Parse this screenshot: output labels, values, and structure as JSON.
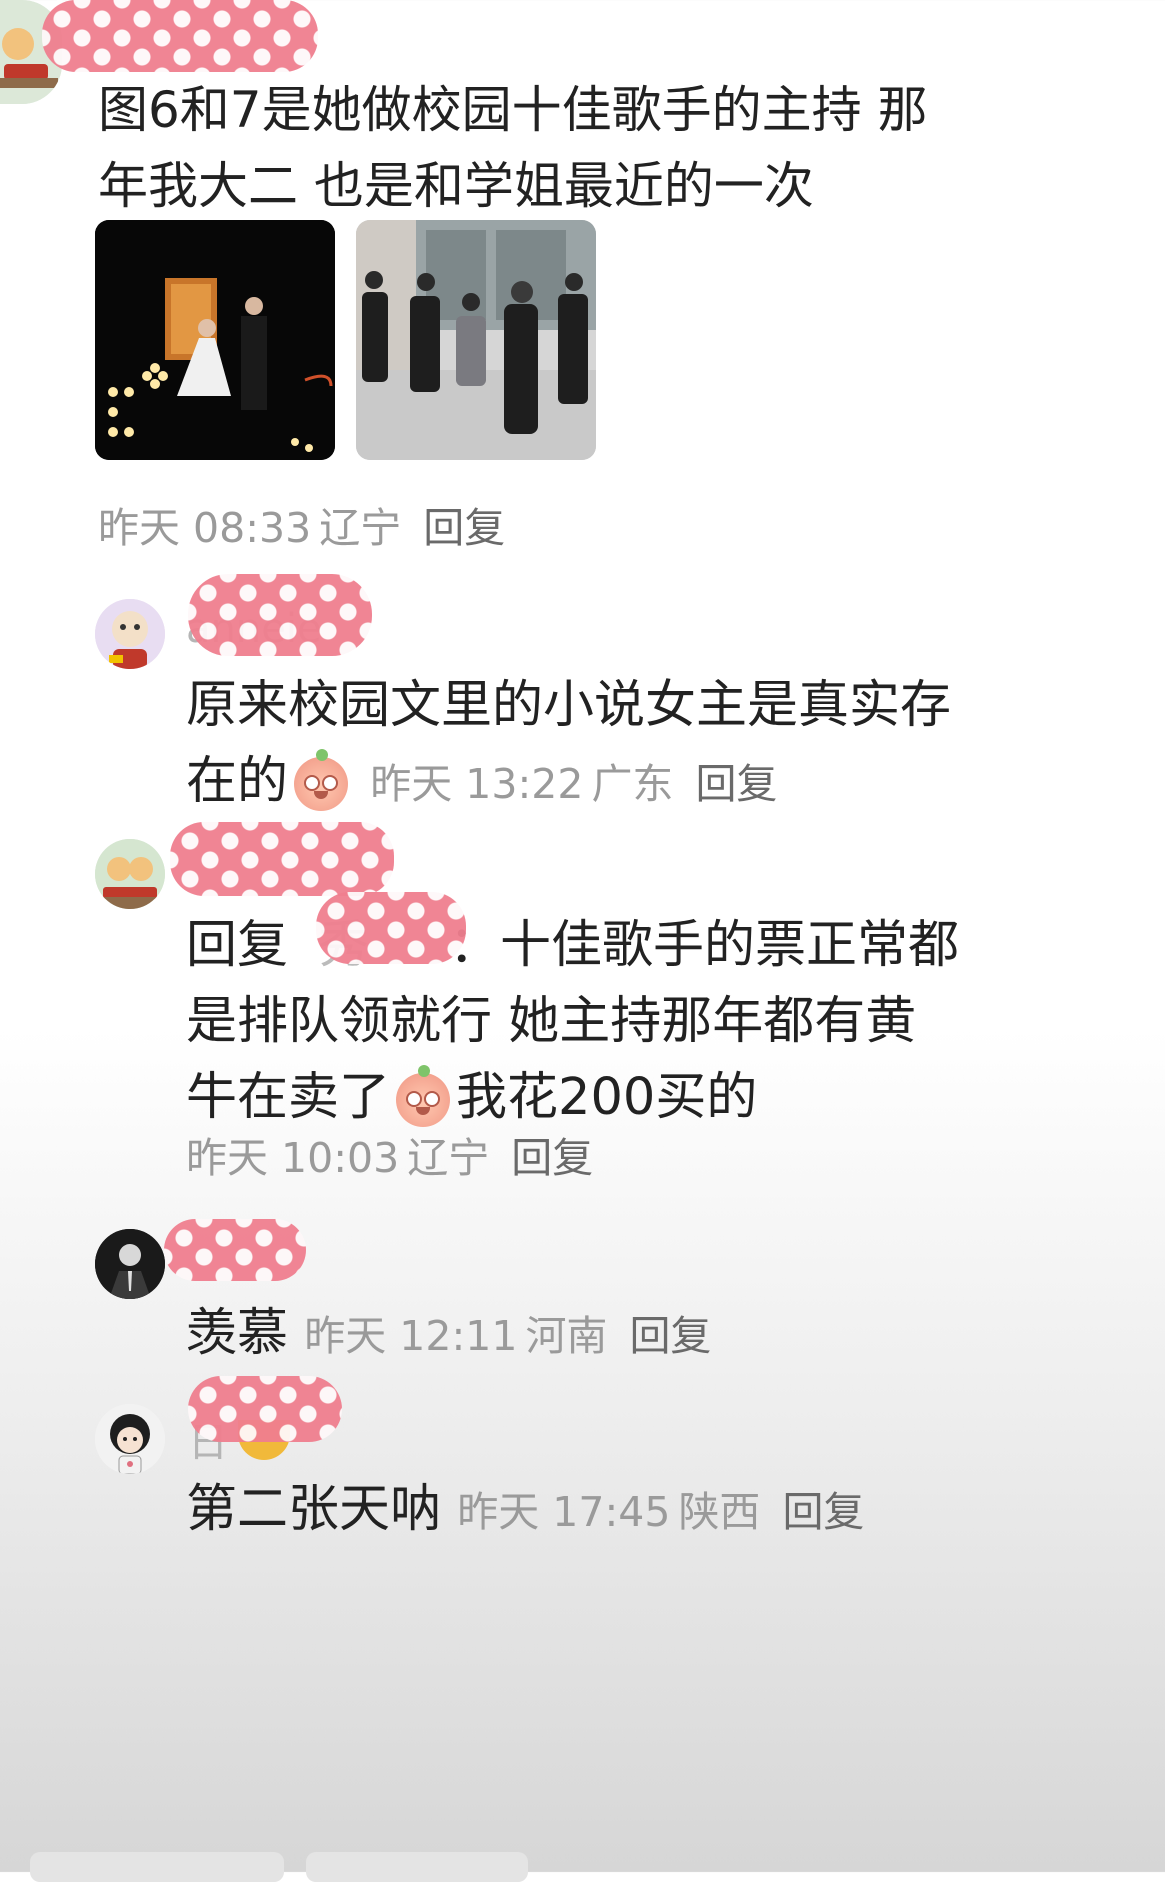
{
  "post": {
    "text": "图6和7是她做校园十佳歌手的主持 那年我大二 也是和学姐最近的一次",
    "time": "昨天 08:33",
    "location": "辽宁",
    "reply_label": "回复"
  },
  "replies": [
    {
      "username_fragment": "anneie",
      "text_before": "原来校园文里的小说女主是真实存在的",
      "emoji": "peach-wow-emoji",
      "time": "昨天 13:22",
      "location": "广东",
      "reply_label": "回复"
    },
    {
      "reply_prefix": "回复",
      "mention_fragment": "秀",
      "text_part1": "：十佳歌手的票正常都是排队领就行 她主持那年都有黄牛在卖了",
      "emoji": "peach-crying-emoji",
      "text_part2": "我花200买的",
      "time": "昨天 10:03",
      "location": "辽宁",
      "reply_label": "回复"
    },
    {
      "text": "羡慕",
      "time": "昨天 12:11",
      "location": "河南",
      "reply_label": "回复"
    },
    {
      "username_fragment": "日",
      "text": "第二张天呐",
      "time": "昨天 17:45",
      "location": "陕西",
      "reply_label": "回复"
    }
  ],
  "colors": {
    "redaction": "#f07f8f",
    "meta_text": "#9a9a9a",
    "main_text": "#222222"
  }
}
